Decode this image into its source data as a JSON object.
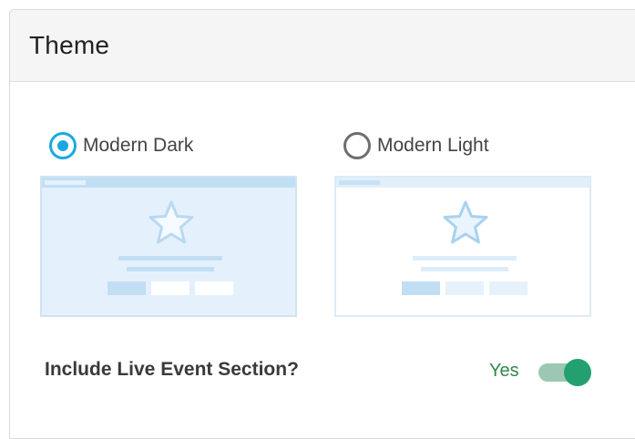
{
  "panel": {
    "title": "Theme"
  },
  "themes": {
    "options": [
      {
        "label": "Modern Dark",
        "selected": true
      },
      {
        "label": "Modern Light",
        "selected": false
      }
    ]
  },
  "live_event": {
    "label": "Include Live Event Section?",
    "value_label": "Yes",
    "enabled": true
  },
  "colors": {
    "accent": "#1ba8e0",
    "toggle_on": "#22a070",
    "yes_text": "#2d8a4e"
  }
}
